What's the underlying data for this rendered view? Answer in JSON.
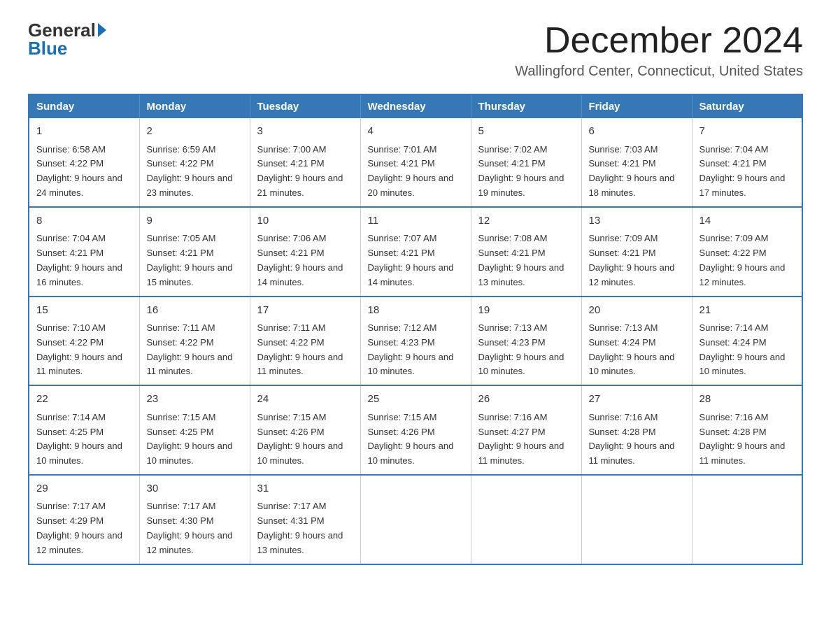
{
  "logo": {
    "general": "General",
    "blue": "Blue"
  },
  "title": {
    "month": "December 2024",
    "location": "Wallingford Center, Connecticut, United States"
  },
  "weekdays": [
    "Sunday",
    "Monday",
    "Tuesday",
    "Wednesday",
    "Thursday",
    "Friday",
    "Saturday"
  ],
  "weeks": [
    [
      {
        "day": "1",
        "sunrise": "6:58 AM",
        "sunset": "4:22 PM",
        "daylight": "9 hours and 24 minutes."
      },
      {
        "day": "2",
        "sunrise": "6:59 AM",
        "sunset": "4:22 PM",
        "daylight": "9 hours and 23 minutes."
      },
      {
        "day": "3",
        "sunrise": "7:00 AM",
        "sunset": "4:21 PM",
        "daylight": "9 hours and 21 minutes."
      },
      {
        "day": "4",
        "sunrise": "7:01 AM",
        "sunset": "4:21 PM",
        "daylight": "9 hours and 20 minutes."
      },
      {
        "day": "5",
        "sunrise": "7:02 AM",
        "sunset": "4:21 PM",
        "daylight": "9 hours and 19 minutes."
      },
      {
        "day": "6",
        "sunrise": "7:03 AM",
        "sunset": "4:21 PM",
        "daylight": "9 hours and 18 minutes."
      },
      {
        "day": "7",
        "sunrise": "7:04 AM",
        "sunset": "4:21 PM",
        "daylight": "9 hours and 17 minutes."
      }
    ],
    [
      {
        "day": "8",
        "sunrise": "7:04 AM",
        "sunset": "4:21 PM",
        "daylight": "9 hours and 16 minutes."
      },
      {
        "day": "9",
        "sunrise": "7:05 AM",
        "sunset": "4:21 PM",
        "daylight": "9 hours and 15 minutes."
      },
      {
        "day": "10",
        "sunrise": "7:06 AM",
        "sunset": "4:21 PM",
        "daylight": "9 hours and 14 minutes."
      },
      {
        "day": "11",
        "sunrise": "7:07 AM",
        "sunset": "4:21 PM",
        "daylight": "9 hours and 14 minutes."
      },
      {
        "day": "12",
        "sunrise": "7:08 AM",
        "sunset": "4:21 PM",
        "daylight": "9 hours and 13 minutes."
      },
      {
        "day": "13",
        "sunrise": "7:09 AM",
        "sunset": "4:21 PM",
        "daylight": "9 hours and 12 minutes."
      },
      {
        "day": "14",
        "sunrise": "7:09 AM",
        "sunset": "4:22 PM",
        "daylight": "9 hours and 12 minutes."
      }
    ],
    [
      {
        "day": "15",
        "sunrise": "7:10 AM",
        "sunset": "4:22 PM",
        "daylight": "9 hours and 11 minutes."
      },
      {
        "day": "16",
        "sunrise": "7:11 AM",
        "sunset": "4:22 PM",
        "daylight": "9 hours and 11 minutes."
      },
      {
        "day": "17",
        "sunrise": "7:11 AM",
        "sunset": "4:22 PM",
        "daylight": "9 hours and 11 minutes."
      },
      {
        "day": "18",
        "sunrise": "7:12 AM",
        "sunset": "4:23 PM",
        "daylight": "9 hours and 10 minutes."
      },
      {
        "day": "19",
        "sunrise": "7:13 AM",
        "sunset": "4:23 PM",
        "daylight": "9 hours and 10 minutes."
      },
      {
        "day": "20",
        "sunrise": "7:13 AM",
        "sunset": "4:24 PM",
        "daylight": "9 hours and 10 minutes."
      },
      {
        "day": "21",
        "sunrise": "7:14 AM",
        "sunset": "4:24 PM",
        "daylight": "9 hours and 10 minutes."
      }
    ],
    [
      {
        "day": "22",
        "sunrise": "7:14 AM",
        "sunset": "4:25 PM",
        "daylight": "9 hours and 10 minutes."
      },
      {
        "day": "23",
        "sunrise": "7:15 AM",
        "sunset": "4:25 PM",
        "daylight": "9 hours and 10 minutes."
      },
      {
        "day": "24",
        "sunrise": "7:15 AM",
        "sunset": "4:26 PM",
        "daylight": "9 hours and 10 minutes."
      },
      {
        "day": "25",
        "sunrise": "7:15 AM",
        "sunset": "4:26 PM",
        "daylight": "9 hours and 10 minutes."
      },
      {
        "day": "26",
        "sunrise": "7:16 AM",
        "sunset": "4:27 PM",
        "daylight": "9 hours and 11 minutes."
      },
      {
        "day": "27",
        "sunrise": "7:16 AM",
        "sunset": "4:28 PM",
        "daylight": "9 hours and 11 minutes."
      },
      {
        "day": "28",
        "sunrise": "7:16 AM",
        "sunset": "4:28 PM",
        "daylight": "9 hours and 11 minutes."
      }
    ],
    [
      {
        "day": "29",
        "sunrise": "7:17 AM",
        "sunset": "4:29 PM",
        "daylight": "9 hours and 12 minutes."
      },
      {
        "day": "30",
        "sunrise": "7:17 AM",
        "sunset": "4:30 PM",
        "daylight": "9 hours and 12 minutes."
      },
      {
        "day": "31",
        "sunrise": "7:17 AM",
        "sunset": "4:31 PM",
        "daylight": "9 hours and 13 minutes."
      },
      null,
      null,
      null,
      null
    ]
  ]
}
